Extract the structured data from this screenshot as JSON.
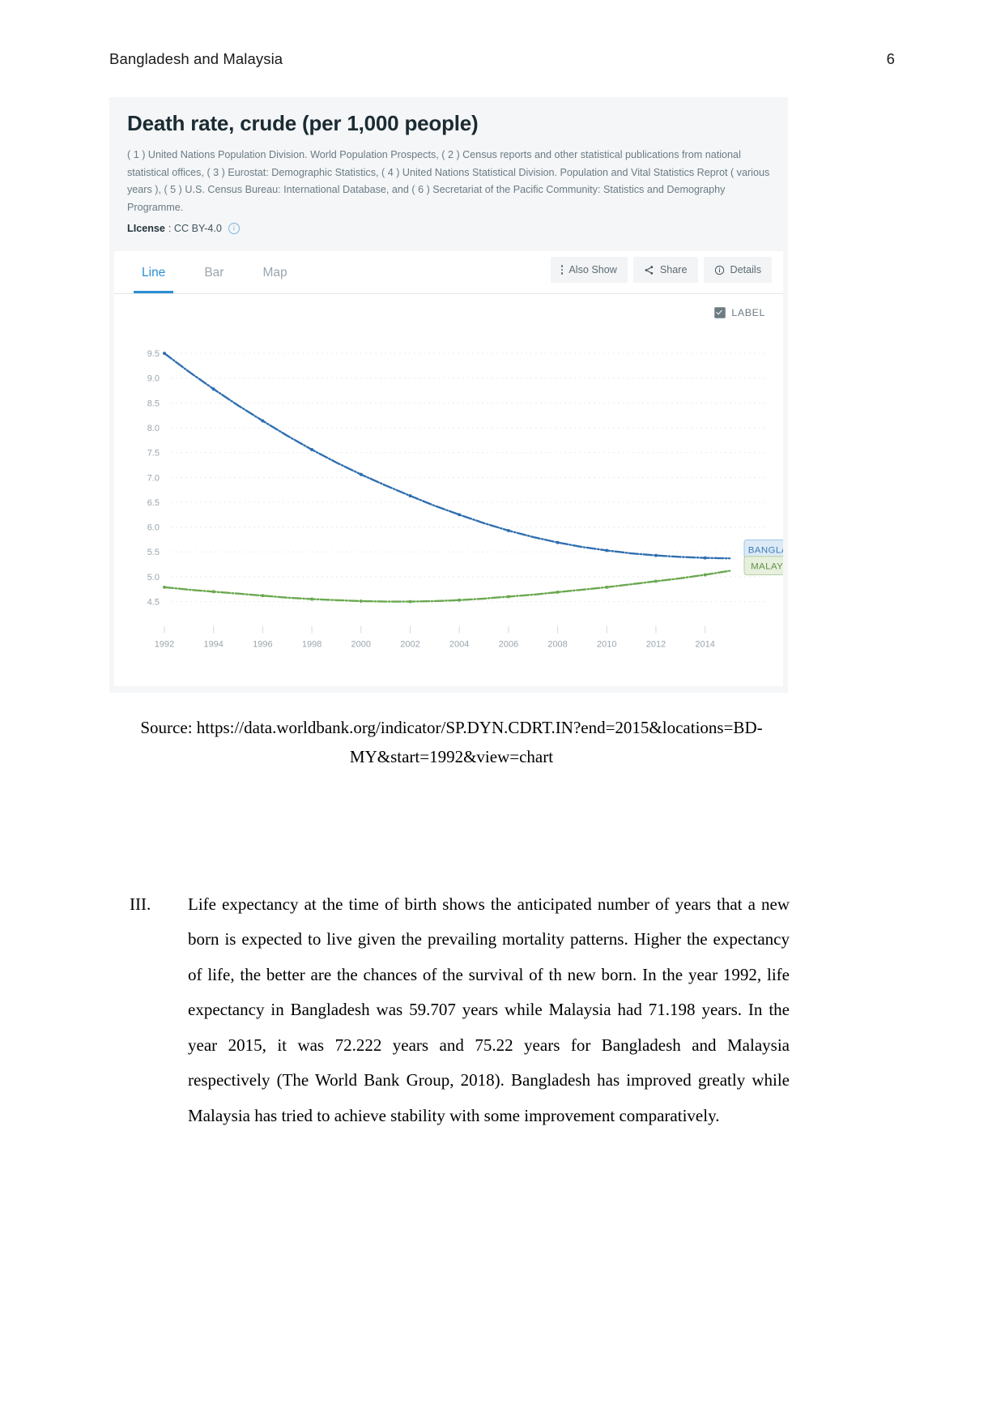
{
  "header": {
    "running_title": "Bangladesh and Malaysia",
    "page_number": "6"
  },
  "widget": {
    "title": "Death rate, crude (per 1,000 people)",
    "description": "( 1 ) United Nations Population Division. World Population Prospects, ( 2 ) Census reports and other statistical publications from national statistical offices, ( 3 ) Eurostat: Demographic Statistics, ( 4 ) United Nations Statistical Division. Population and Vital Statistics Reprot ( various years ), ( 5 ) U.S. Census Bureau: International Database, and ( 6 ) Secretariat of the Pacific Community: Statistics and Demography Programme.",
    "license_label": "LIcense",
    "license_value": ": CC BY-4.0",
    "tabs": [
      {
        "label": "Line",
        "active": true
      },
      {
        "label": "Bar",
        "active": false
      },
      {
        "label": "Map",
        "active": false
      }
    ],
    "actions": [
      {
        "label": "Also Show",
        "icon": "kebab-icon"
      },
      {
        "label": "Share",
        "icon": "share-icon"
      },
      {
        "label": "Details",
        "icon": "info-circle-icon"
      }
    ],
    "label_toggle": {
      "label": "LABEL",
      "checked": true
    },
    "colors": {
      "bangladesh": "#2f6fb0",
      "malaysia": "#6aa84f",
      "accent": "#2b8fd4",
      "grid": "#e8ebed"
    }
  },
  "chart_data": {
    "type": "line",
    "title": "Death rate, crude (per 1,000 people)",
    "xlabel": "",
    "ylabel": "",
    "xlim": [
      1992,
      2015
    ],
    "ylim": [
      4.3,
      9.7
    ],
    "grid": true,
    "legend_position": "inline-right",
    "x_ticks": [
      "1992",
      "1994",
      "1996",
      "1998",
      "2000",
      "2002",
      "2004",
      "2006",
      "2008",
      "2010",
      "2012",
      "2014"
    ],
    "y_ticks": [
      "9.5",
      "9.0",
      "8.5",
      "8.0",
      "7.5",
      "7.0",
      "6.5",
      "6.0",
      "5.5",
      "5.0",
      "4.5"
    ],
    "x": [
      1992,
      1993,
      1994,
      1995,
      1996,
      1997,
      1998,
      1999,
      2000,
      2001,
      2002,
      2003,
      2004,
      2005,
      2006,
      2007,
      2008,
      2009,
      2010,
      2011,
      2012,
      2013,
      2014,
      2015
    ],
    "series": [
      {
        "name": "BANGLADESH",
        "color": "#2f6fb0",
        "values": [
          9.5,
          9.13,
          8.78,
          8.45,
          8.14,
          7.84,
          7.56,
          7.3,
          7.06,
          6.84,
          6.63,
          6.43,
          6.25,
          6.08,
          5.93,
          5.8,
          5.69,
          5.6,
          5.53,
          5.47,
          5.43,
          5.4,
          5.38,
          5.37
        ]
      },
      {
        "name": "MALAYSIA",
        "color": "#6aa84f",
        "values": [
          4.79,
          4.74,
          4.7,
          4.66,
          4.62,
          4.58,
          4.55,
          4.53,
          4.51,
          4.5,
          4.5,
          4.51,
          4.53,
          4.56,
          4.6,
          4.64,
          4.69,
          4.74,
          4.79,
          4.85,
          4.91,
          4.97,
          5.04,
          5.12
        ]
      }
    ]
  },
  "source_caption": "Source: https://data.worldbank.org/indicator/SP.DYN.CDRT.IN?end=2015&locations=BD-MY&start=1992&view=chart",
  "body": {
    "marker": "III.",
    "paragraph": "Life expectancy at the time of birth shows the anticipated number of years that a new born is expected to live given the prevailing mortality patterns. Higher the expectancy of life, the better are the chances of the survival of th new born. In the year 1992, life expectancy in Bangladesh was 59.707 years while Malaysia had 71.198 years. In the year 2015, it was 72.222 years and 75.22 years for Bangladesh and Malaysia respectively (The World Bank Group, 2018). Bangladesh has improved greatly while Malaysia has tried to achieve stability with some improvement comparatively."
  }
}
